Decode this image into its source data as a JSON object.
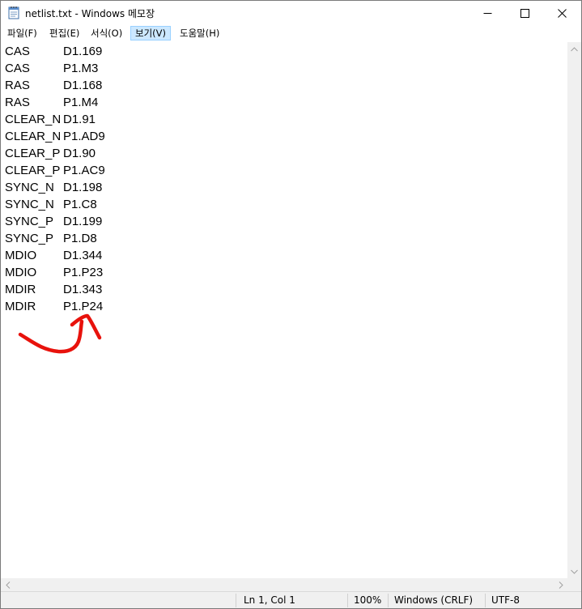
{
  "window": {
    "title": "netlist.txt - Windows 메모장",
    "icon": "notepad-icon",
    "controls": [
      "minimize-icon",
      "maximize-icon",
      "close-icon"
    ]
  },
  "menu": [
    {
      "label": "파일(F)"
    },
    {
      "label": "편집(E)"
    },
    {
      "label": "서식(O)"
    },
    {
      "label": "보기(V)",
      "active": true
    },
    {
      "label": "도움말(H)"
    }
  ],
  "lines": [
    {
      "net": "CAS",
      "pin": "D1.169"
    },
    {
      "net": "CAS",
      "pin": "P1.M3"
    },
    {
      "net": "RAS",
      "pin": "D1.168"
    },
    {
      "net": "RAS",
      "pin": "P1.M4"
    },
    {
      "net": "CLEAR_N",
      "pin": "D1.91"
    },
    {
      "net": "CLEAR_N",
      "pin": "P1.AD9"
    },
    {
      "net": "CLEAR_P",
      "pin": "D1.90"
    },
    {
      "net": "CLEAR_P",
      "pin": "P1.AC9"
    },
    {
      "net": "SYNC_N",
      "pin": "D1.198"
    },
    {
      "net": "SYNC_N",
      "pin": "P1.C8"
    },
    {
      "net": "SYNC_P",
      "pin": "D1.199"
    },
    {
      "net": "SYNC_P",
      "pin": "P1.D8"
    },
    {
      "net": "MDIO",
      "pin": "D1.344"
    },
    {
      "net": "MDIO",
      "pin": "P1.P23"
    },
    {
      "net": "MDIR",
      "pin": "D1.343"
    },
    {
      "net": "MDIR",
      "pin": "P1.P24"
    }
  ],
  "annotation": {
    "color": "#e8120c",
    "icon": "hand-drawn-arrow"
  },
  "status": {
    "position": "Ln 1, Col 1",
    "zoom": "100%",
    "line_ending": "Windows (CRLF)",
    "encoding": "UTF-8"
  }
}
